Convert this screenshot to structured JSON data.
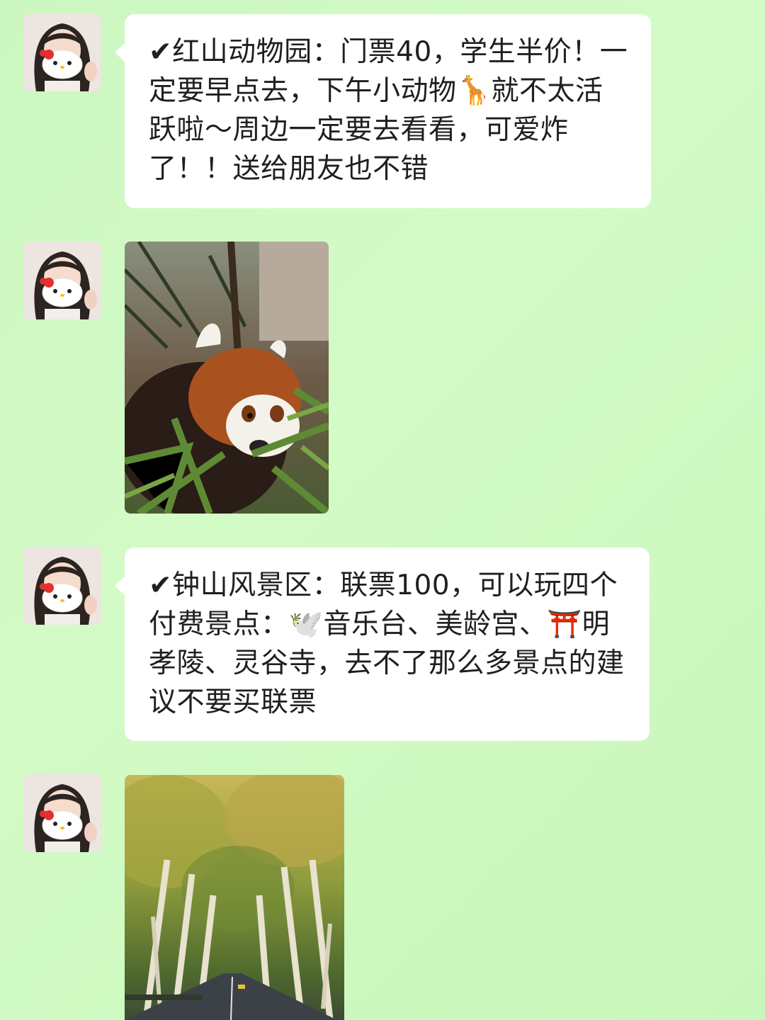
{
  "messages": [
    {
      "type": "text",
      "text": "✔红山动物园：门票40，学生半价！一定要早点去，下午小动物🦒就不太活跃啦～周边一定要去看看，可爱炸了！！送给朋友也不错"
    },
    {
      "type": "image",
      "subject": "red-panda-photo"
    },
    {
      "type": "text",
      "text": "✔钟山风景区：联票100，可以玩四个付费景点：🕊️音乐台、美龄宫、⛩️明孝陵、灵谷寺，去不了那么多景点的建议不要买联票"
    },
    {
      "type": "image",
      "subject": "tree-lined-road-photo"
    }
  ],
  "colors": {
    "background": "#cef8c2",
    "bubble": "#ffffff",
    "text": "#1f1f1f"
  }
}
